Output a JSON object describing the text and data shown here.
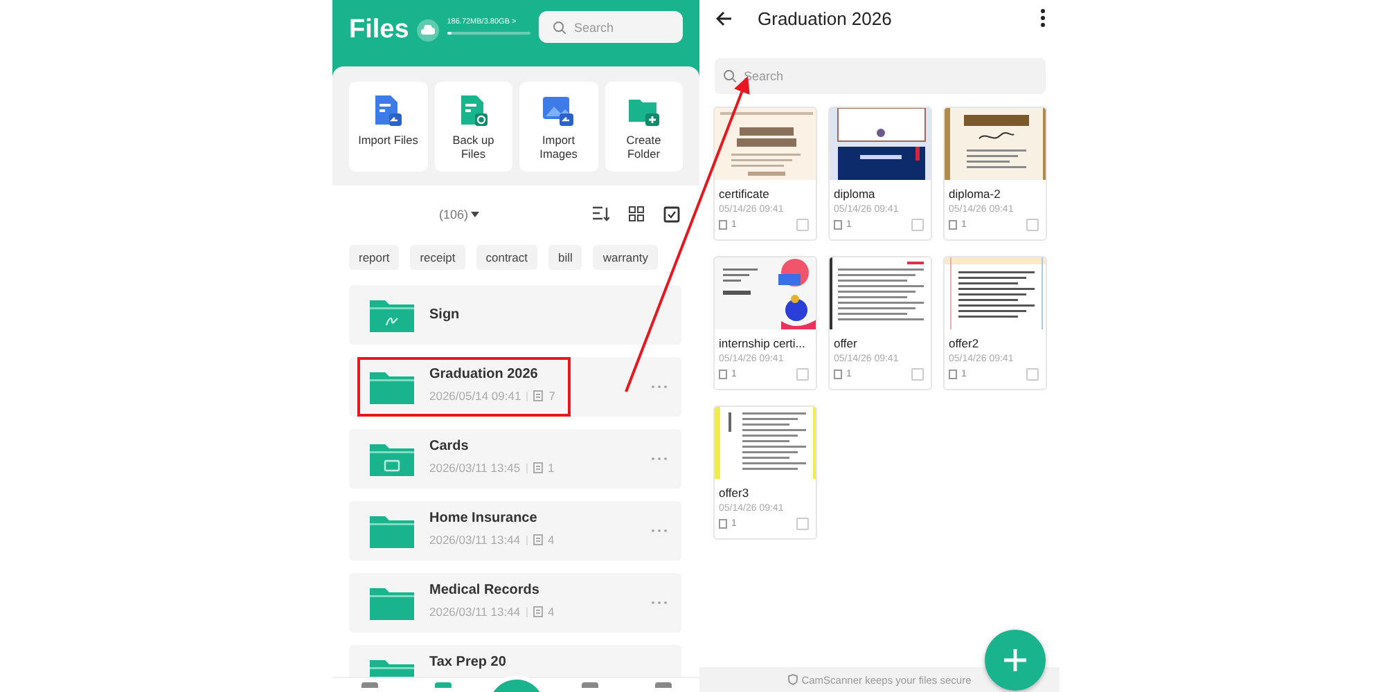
{
  "files_panel": {
    "title": "Files",
    "storage": {
      "text": "186.72MB/3.80GB >",
      "level": 0.06
    },
    "search": {
      "placeholder": "Search"
    },
    "actions": [
      {
        "label": "Import Files",
        "kind": "import-files"
      },
      {
        "label": "Back up Files",
        "kind": "backup"
      },
      {
        "label": "Import Images",
        "kind": "import-images"
      },
      {
        "label": "Create Folder",
        "kind": "create-folder"
      }
    ],
    "count": "(106)",
    "tags": [
      "report",
      "receipt",
      "contract",
      "bill",
      "warranty"
    ],
    "folders": [
      {
        "name": "Sign",
        "kind": "signature",
        "highlighted": false
      },
      {
        "name": "Graduation 2026",
        "date": "2026/05/14 09:41",
        "count": "7",
        "kind": "plain",
        "highlighted": true
      },
      {
        "name": "Cards",
        "date": "2026/03/11 13:45",
        "count": "1",
        "kind": "card",
        "highlighted": false
      },
      {
        "name": "Home Insurance",
        "date": "2026/03/11 13:44",
        "count": "4",
        "kind": "plain",
        "highlighted": false
      },
      {
        "name": "Medical Records",
        "date": "2026/03/11 13:44",
        "count": "4",
        "kind": "plain",
        "highlighted": false
      },
      {
        "name": "Tax Prep 20",
        "kind": "plain",
        "highlighted": false
      }
    ]
  },
  "folder_view": {
    "title": "Graduation 2026",
    "search": {
      "placeholder": "Search"
    },
    "documents": [
      {
        "name": "certificate",
        "date": "05/14/26 09:41",
        "pages": "1",
        "checked": false
      },
      {
        "name": "diploma",
        "date": "05/14/26 09:41",
        "pages": "1",
        "checked": false
      },
      {
        "name": "diploma-2",
        "date": "05/14/26 09:41",
        "pages": "1",
        "checked": false
      },
      {
        "name": "internship certi...",
        "date": "05/14/26 09:41",
        "pages": "1",
        "checked": false
      },
      {
        "name": "offer",
        "date": "05/14/26 09:41",
        "pages": "1",
        "checked": false
      },
      {
        "name": "offer2",
        "date": "05/14/26 09:41",
        "pages": "1",
        "checked": false
      },
      {
        "name": "offer3",
        "date": "05/14/26 09:41",
        "pages": "1",
        "checked": false
      }
    ],
    "footer": "CamScanner keeps your files secure"
  }
}
